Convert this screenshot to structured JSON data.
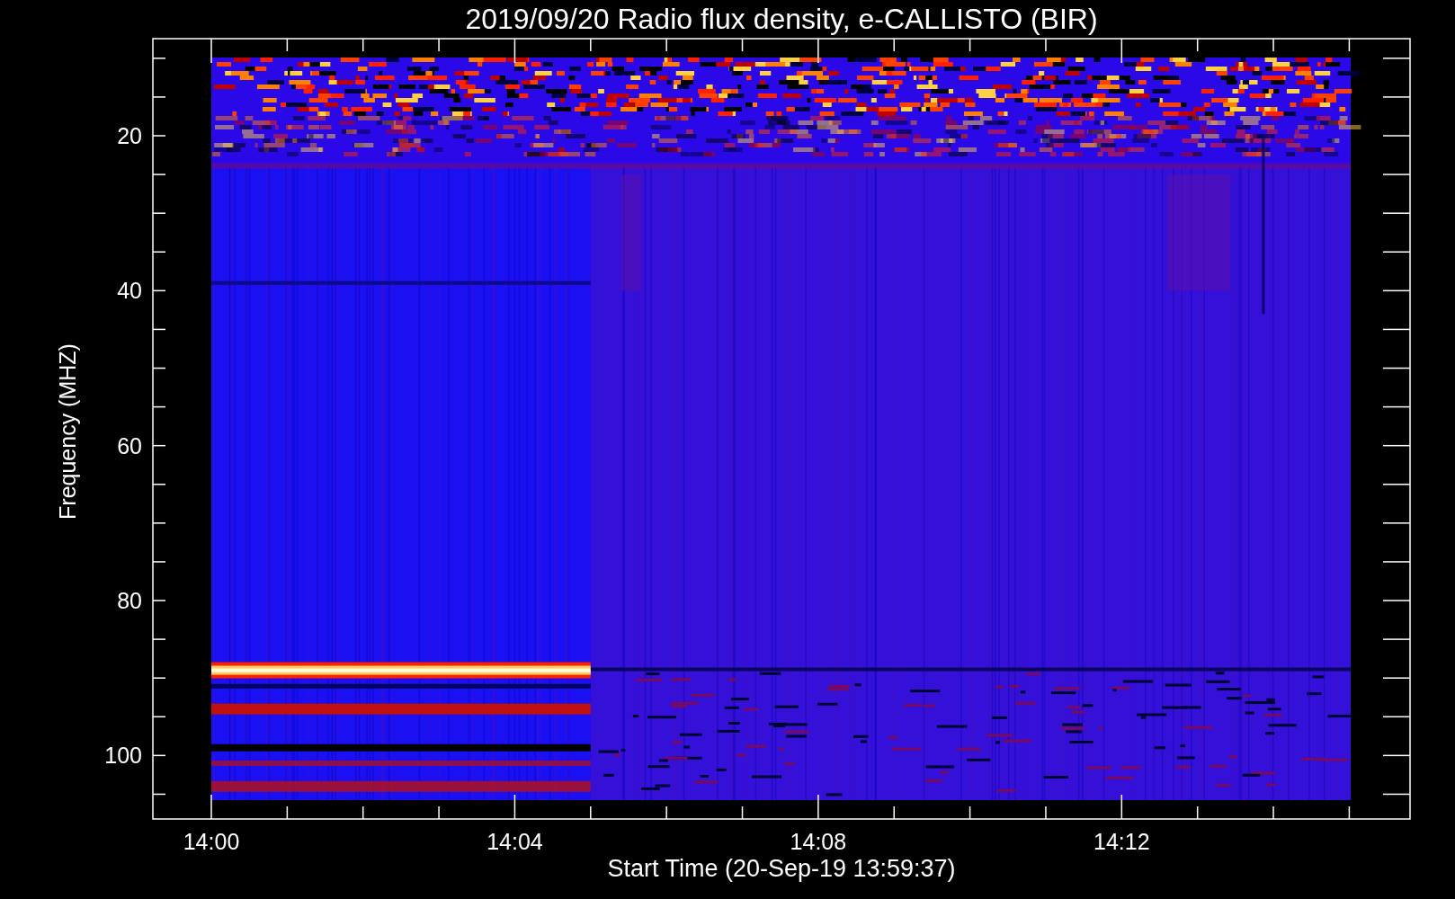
{
  "title": "2019/09/20  Radio flux density, e-CALLISTO (BIR)",
  "y_axis": {
    "label": "Frequency (MHZ)",
    "ticks": [
      "20",
      "40",
      "60",
      "80",
      "100"
    ]
  },
  "x_axis": {
    "label": "Start Time (20-Sep-19 13:59:37)",
    "ticks": [
      "14:00",
      "14:04",
      "14:08",
      "14:12"
    ]
  }
}
